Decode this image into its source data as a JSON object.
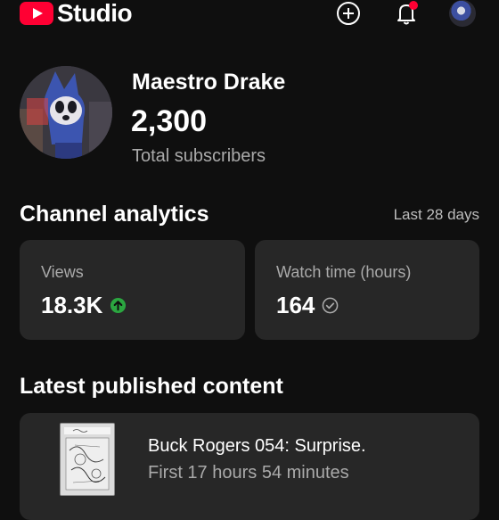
{
  "header": {
    "app_name": "Studio",
    "icons": [
      "youtube-logo-icon",
      "create-plus-icon",
      "notifications-bell-icon",
      "account-avatar"
    ],
    "notification_dot_color": "#ff0033"
  },
  "channel": {
    "name": "Maestro Drake",
    "subscribers": "2,300",
    "subscribers_label": "Total subscribers"
  },
  "analytics": {
    "title": "Channel analytics",
    "period": "Last 28 days",
    "cards": [
      {
        "label": "Views",
        "value": "18.3K",
        "status_icon": "arrow-up-circle-icon",
        "status_color": "#2ba640"
      },
      {
        "label": "Watch time (hours)",
        "value": "164",
        "status_icon": "check-circle-icon",
        "status_color": "#aaaaaa"
      }
    ]
  },
  "latest": {
    "title": "Latest published content",
    "video": {
      "title": "Buck Rogers 054: Surprise.",
      "meta": "First 17 hours 54 minutes"
    }
  }
}
